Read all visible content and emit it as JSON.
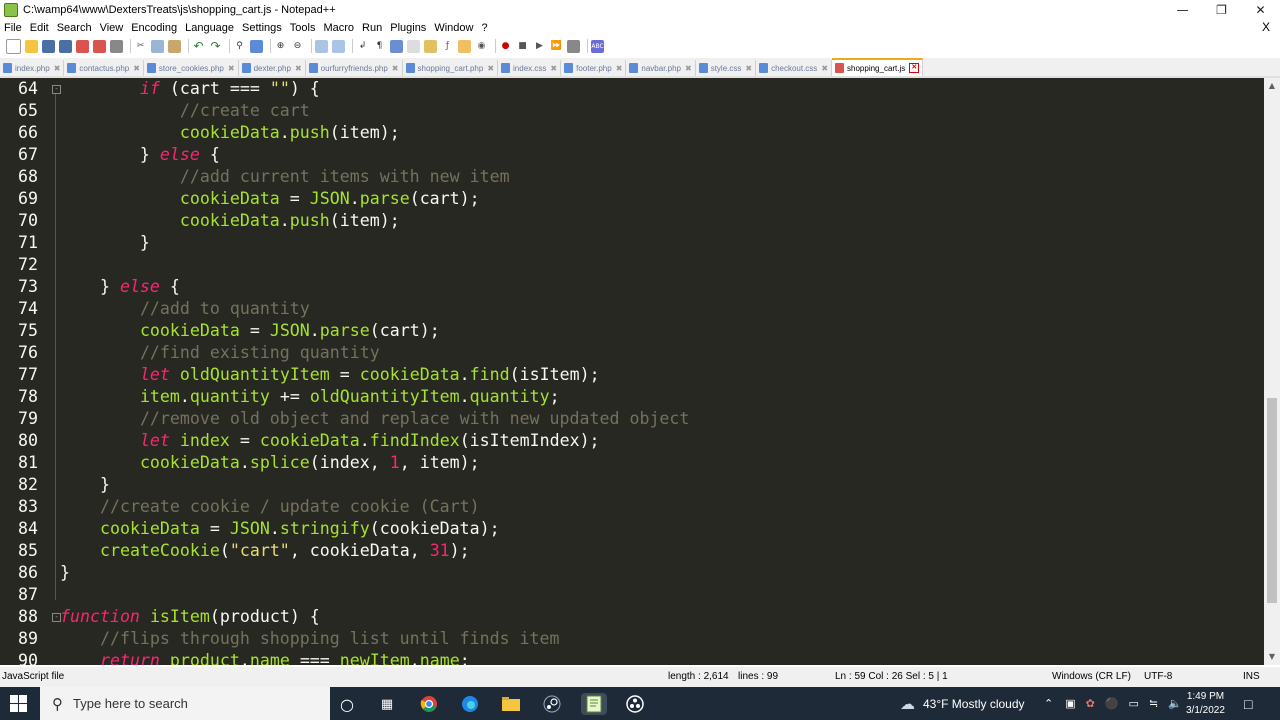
{
  "window": {
    "title": "C:\\wamp64\\www\\DextersTreats\\js\\shopping_cart.js - Notepad++"
  },
  "menu": [
    "File",
    "Edit",
    "Search",
    "View",
    "Encoding",
    "Language",
    "Settings",
    "Tools",
    "Macro",
    "Run",
    "Plugins",
    "Window",
    "?"
  ],
  "menu_close": "X",
  "tabs": [
    {
      "label": "index.php"
    },
    {
      "label": "contactus.php"
    },
    {
      "label": "store_cookies.php"
    },
    {
      "label": "dexter.php"
    },
    {
      "label": "ourfurryfriends.php"
    },
    {
      "label": "shopping_cart.php"
    },
    {
      "label": "index.css"
    },
    {
      "label": "footer.php"
    },
    {
      "label": "navbar.php"
    },
    {
      "label": "style.css"
    },
    {
      "label": "checkout.css"
    },
    {
      "label": "shopping_cart.js",
      "active": true
    }
  ],
  "code_lines": [
    {
      "n": "64",
      "html": "        <span class='k'>if</span> (cart === <span class='s'>\"\"</span>) {"
    },
    {
      "n": "65",
      "html": "            <span class='c'>//create cart</span>"
    },
    {
      "n": "66",
      "html": "            <span class='f'>cookieData</span>.<span class='f'>push</span>(item);"
    },
    {
      "n": "67",
      "html": "        } <span class='k'>else</span> {"
    },
    {
      "n": "68",
      "html": "            <span class='c'>//add current items with new item</span>"
    },
    {
      "n": "69",
      "html": "            <span class='f'>cookieData</span> = <span class='f'>JSON</span>.<span class='f'>parse</span>(cart);"
    },
    {
      "n": "70",
      "html": "            <span class='f'>cookieData</span>.<span class='f'>push</span>(item);"
    },
    {
      "n": "71",
      "html": "        }"
    },
    {
      "n": "72",
      "html": ""
    },
    {
      "n": "73",
      "html": "    } <span class='k'>else</span> {"
    },
    {
      "n": "74",
      "html": "        <span class='c'>//add to quantity</span>"
    },
    {
      "n": "75",
      "html": "        <span class='f'>cookieData</span> = <span class='f'>JSON</span>.<span class='f'>parse</span>(cart);"
    },
    {
      "n": "76",
      "html": "        <span class='c'>//find existing quantity</span>"
    },
    {
      "n": "77",
      "html": "        <span class='k'>let</span> <span class='f'>oldQuantityItem</span> = <span class='f'>cookieData</span>.<span class='f'>find</span>(isItem);"
    },
    {
      "n": "78",
      "html": "        <span class='f'>item</span>.<span class='f'>quantity</span> += <span class='f'>oldQuantityItem</span>.<span class='f'>quantity</span>;"
    },
    {
      "n": "79",
      "html": "        <span class='c'>//remove old object and replace with new updated object</span>"
    },
    {
      "n": "80",
      "html": "        <span class='k'>let</span> <span class='f'>index</span> = <span class='f'>cookieData</span>.<span class='f'>findIndex</span>(isItemIndex);"
    },
    {
      "n": "81",
      "html": "        <span class='f'>cookieData</span>.<span class='f'>splice</span>(index, <span class='n'>1</span>, item);"
    },
    {
      "n": "82",
      "html": "    }"
    },
    {
      "n": "83",
      "html": "    <span class='c'>//create cookie / update cookie (Cart)</span>"
    },
    {
      "n": "84",
      "html": "    <span class='f'>cookieData</span> = <span class='f'>JSON</span>.<span class='f'>stringify</span>(cookieData);"
    },
    {
      "n": "85",
      "html": "    <span class='f'>createCookie</span>(<span class='s'>\"cart\"</span>, cookieData, <span class='n'>31</span>);"
    },
    {
      "n": "86",
      "html": "}"
    },
    {
      "n": "87",
      "html": ""
    },
    {
      "n": "88",
      "html": "<span class='k'>function</span> <span class='f'>isItem</span>(product) {"
    },
    {
      "n": "89",
      "html": "    <span class='c'>//flips through shopping list until finds item</span>"
    },
    {
      "n": "90",
      "html": "    <span class='k'>return</span> <span class='f'>product</span>.<span class='f'>name</span> === <span class='f'>newItem</span>.<span class='f'>name</span>;"
    }
  ],
  "status": {
    "filetype": "JavaScript file",
    "length": "length : 2,614",
    "lines": "lines : 99",
    "pos": "Ln : 59    Col : 26    Sel : 5 | 1",
    "eol": "Windows (CR LF)",
    "enc": "UTF-8",
    "mode": "INS"
  },
  "taskbar": {
    "search_placeholder": "Type here to search",
    "weather": "43°F  Mostly cloudy",
    "time": "1:49 PM",
    "date": "3/1/2022"
  },
  "colors": {
    "editor_bg": "#272822",
    "keyword": "#f92672",
    "function": "#a6e22e",
    "comment": "#75715e",
    "string": "#e6db74"
  }
}
